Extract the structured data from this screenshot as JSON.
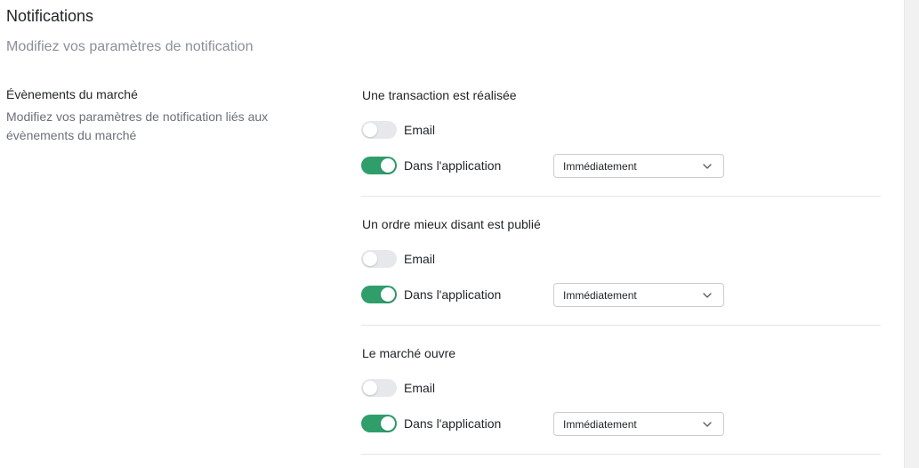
{
  "header": {
    "title": "Notifications",
    "subtitle": "Modifiez vos paramètres de notification"
  },
  "section": {
    "title": "Évènements du marché",
    "description": "Modifiez vos paramètres de notification liés aux évènements du marché"
  },
  "events": [
    {
      "title": "Une transaction est réalisée",
      "email_label": "Email",
      "email_enabled": false,
      "app_label": "Dans l'application",
      "app_enabled": true,
      "frequency": "Immédiatement"
    },
    {
      "title": "Un ordre mieux disant est publié",
      "email_label": "Email",
      "email_enabled": false,
      "app_label": "Dans l'application",
      "app_enabled": true,
      "frequency": "Immédiatement"
    },
    {
      "title": "Le marché ouvre",
      "email_label": "Email",
      "email_enabled": false,
      "app_label": "Dans l'application",
      "app_enabled": true,
      "frequency": "Immédiatement"
    }
  ],
  "colors": {
    "toggle_on": "#2f9e6b",
    "toggle_off": "#e6e8eb"
  }
}
